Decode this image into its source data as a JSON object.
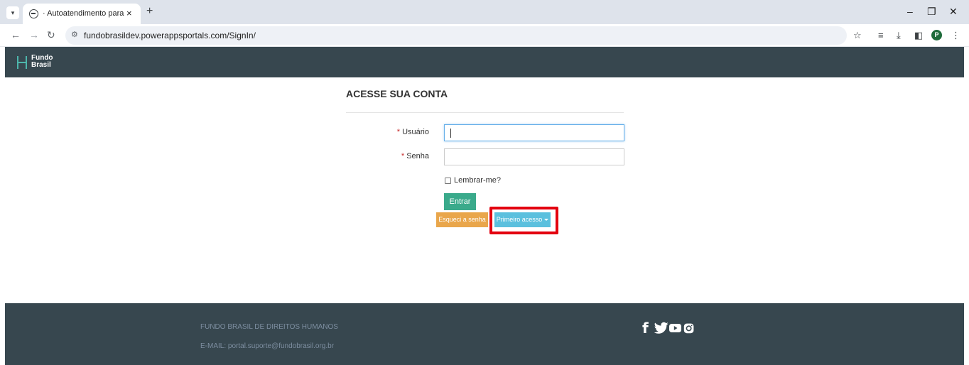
{
  "browser": {
    "tab_title": "· Autoatendimento para Client",
    "tab_close": "×",
    "new_tab": "+",
    "url": "fundobrasildev.powerappsportals.com/SignIn/",
    "icons": [
      "tab-list-icon",
      "globe-icon",
      "back-icon",
      "forward-icon",
      "reload-icon",
      "site-info-icon",
      "star-icon",
      "reading-list-icon",
      "download-icon",
      "side-panel-icon",
      "profile-icon",
      "menu-icon",
      "minimize-icon",
      "restore-icon",
      "close-icon"
    ],
    "profile_initial": "P"
  },
  "header": {
    "logo_line1": "Fundo",
    "logo_line2": "Brasil",
    "bg_color": "#37474f"
  },
  "form": {
    "title": "ACESSE SUA CONTA",
    "required_mark": "*",
    "username_label": "Usuário",
    "password_label": "Senha",
    "remember_label": "Lembrar-me?",
    "submit_label": "Entrar",
    "forgot_label": "Esqueci a senha",
    "first_access_label": "Primeiro acesso"
  },
  "footer": {
    "org_name": "FUNDO BRASIL DE DIREITOS HUMANOS",
    "email": "E-MAIL:  portal.suporte@fundobrasil.org.br",
    "social": [
      "facebook-icon",
      "twitter-icon",
      "youtube-icon",
      "instagram-icon"
    ],
    "facebook_glyph": "f"
  },
  "colors": {
    "accent_green": "#3aaa8b",
    "warning_orange": "#e9a64b",
    "info_blue": "#5bc0de",
    "highlight_red": "#e3000f"
  }
}
